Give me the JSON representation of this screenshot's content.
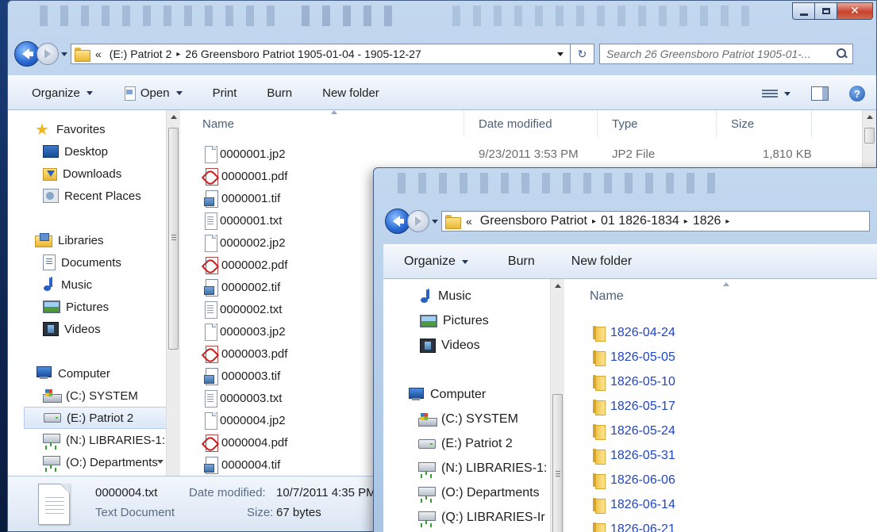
{
  "window1": {
    "address": {
      "prefix": "«",
      "crumbs": [
        "(E:) Patriot 2",
        "26 Greensboro Patriot 1905-01-04 - 1905-12-27"
      ],
      "separator": "▸"
    },
    "search_placeholder": "Search 26 Greensboro Patriot 1905-01-...",
    "toolbar": {
      "organize": "Organize",
      "open": "Open",
      "print": "Print",
      "burn": "Burn",
      "new_folder": "New folder"
    },
    "nav": {
      "favorites": "Favorites",
      "desktop": "Desktop",
      "downloads": "Downloads",
      "recent_places": "Recent Places",
      "libraries": "Libraries",
      "documents": "Documents",
      "music": "Music",
      "pictures": "Pictures",
      "videos": "Videos",
      "computer": "Computer",
      "drive_c": "(C:) SYSTEM",
      "drive_e": "(E:) Patriot 2",
      "drive_n": "(N:) LIBRARIES-1:",
      "drive_o": "(O:) Departments"
    },
    "columns": {
      "name": "Name",
      "date_modified": "Date modified",
      "type": "Type",
      "size": "Size"
    },
    "files": [
      {
        "name": "0000001.jp2",
        "kind": "file",
        "date": "9/23/2011 3:53 PM",
        "type": "JP2 File",
        "size": "1,810 KB"
      },
      {
        "name": "0000001.pdf",
        "kind": "pdf"
      },
      {
        "name": "0000001.tif",
        "kind": "tif"
      },
      {
        "name": "0000001.txt",
        "kind": "txt"
      },
      {
        "name": "0000002.jp2",
        "kind": "file"
      },
      {
        "name": "0000002.pdf",
        "kind": "pdf"
      },
      {
        "name": "0000002.tif",
        "kind": "tif"
      },
      {
        "name": "0000002.txt",
        "kind": "txt"
      },
      {
        "name": "0000003.jp2",
        "kind": "file"
      },
      {
        "name": "0000003.pdf",
        "kind": "pdf"
      },
      {
        "name": "0000003.tif",
        "kind": "tif"
      },
      {
        "name": "0000003.txt",
        "kind": "txt"
      },
      {
        "name": "0000004.jp2",
        "kind": "file"
      },
      {
        "name": "0000004.pdf",
        "kind": "pdf"
      },
      {
        "name": "0000004.tif",
        "kind": "tif"
      }
    ],
    "details": {
      "filename": "0000004.txt",
      "filetype": "Text Document",
      "date_label": "Date modified:",
      "date_value": "10/7/2011 4:35 PM",
      "size_label": "Size:",
      "size_value": "67 bytes"
    }
  },
  "window2": {
    "address": {
      "prefix": "«",
      "crumbs": [
        "Greensboro Patriot",
        "01 1826-1834",
        "1826"
      ],
      "separator": "▸"
    },
    "toolbar": {
      "organize": "Organize",
      "burn": "Burn",
      "new_folder": "New folder"
    },
    "nav": {
      "music": "Music",
      "pictures": "Pictures",
      "videos": "Videos",
      "computer": "Computer",
      "drive_c": "(C:) SYSTEM",
      "drive_e": "(E:) Patriot 2",
      "drive_n": "(N:) LIBRARIES-1:",
      "drive_o": "(O:) Departments",
      "drive_q": "(Q:) LIBRARIES-Ir"
    },
    "columns": {
      "name": "Name"
    },
    "folders": [
      "1826-04-24",
      "1826-05-05",
      "1826-05-10",
      "1826-05-17",
      "1826-05-24",
      "1826-05-31",
      "1826-06-06",
      "1826-06-14",
      "1826-06-21"
    ]
  },
  "icons": {
    "back": "back-arrow-icon",
    "forward": "forward-arrow-icon",
    "refresh": "refresh-icon",
    "search": "search-icon",
    "minimize": "minimize-icon",
    "maximize": "maximize-icon",
    "close": "close-icon",
    "refresh_glyph": "↻"
  },
  "caption_close_glyph": "✕",
  "help_glyph": "?"
}
